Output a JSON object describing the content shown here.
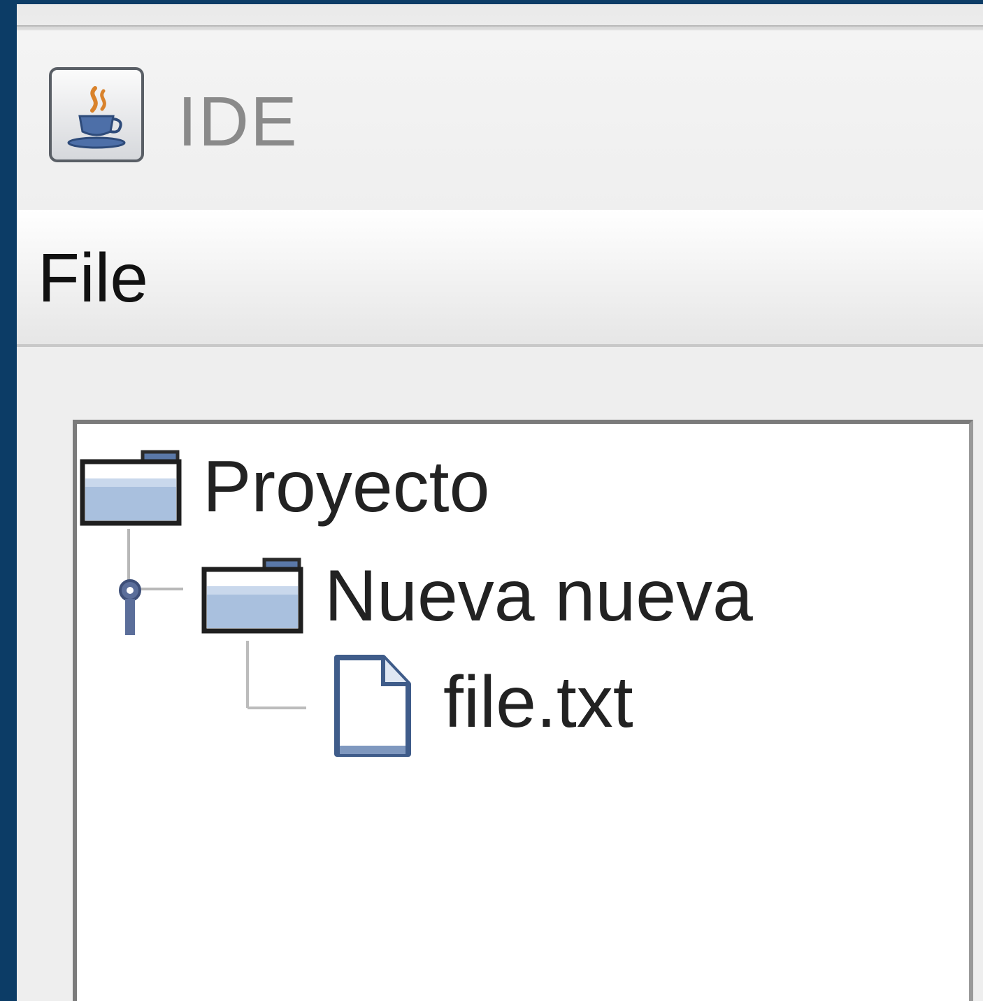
{
  "window": {
    "title": "IDE",
    "icon": "java-coffee-cup-icon"
  },
  "menu": {
    "items": [
      {
        "label": "File"
      }
    ]
  },
  "tree": {
    "nodes": [
      {
        "label": "Proyecto",
        "icon": "folder-icon",
        "level": 0
      },
      {
        "label": "Nueva nueva",
        "icon": "folder-icon",
        "level": 1,
        "expanded": true
      },
      {
        "label": "file.txt",
        "icon": "file-icon",
        "level": 2
      }
    ]
  },
  "colors": {
    "desktop": "#0c3c66",
    "window_bg": "#eeeeee",
    "tree_bg": "#ffffff",
    "tree_border": "#7b7b7b",
    "handle": "#5b6e9a",
    "text": "#222222"
  }
}
